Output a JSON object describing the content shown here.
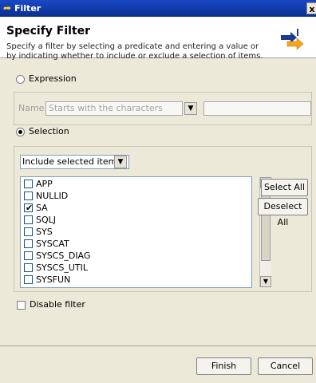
{
  "window": {
    "title": "Filter",
    "close_glyph": "x"
  },
  "banner": {
    "title": "Specify Filter",
    "description": "Specify a filter by selecting a predicate and entering a value or by indicating whether to include or exclude a selection of items.",
    "icon": "filter-arrows-icon"
  },
  "expression": {
    "radio_label": "Expression",
    "selected": false,
    "name_label": "Name:",
    "predicate_value": "Starts with the characters",
    "value_text": ""
  },
  "selection": {
    "radio_label": "Selection",
    "selected": true,
    "mode_value": "Include selected items",
    "items": [
      {
        "label": "APP",
        "checked": false
      },
      {
        "label": "NULLID",
        "checked": false
      },
      {
        "label": "SA",
        "checked": true
      },
      {
        "label": "SQLJ",
        "checked": false
      },
      {
        "label": "SYS",
        "checked": false
      },
      {
        "label": "SYSCAT",
        "checked": false
      },
      {
        "label": "SYSCS_DIAG",
        "checked": false
      },
      {
        "label": "SYSCS_UTIL",
        "checked": false
      },
      {
        "label": "SYSFUN",
        "checked": false
      }
    ],
    "select_all_label": "Select All",
    "deselect_all_label": "Deselect All"
  },
  "disable_filter": {
    "label": "Disable filter",
    "checked": false
  },
  "footer": {
    "finish_label": "Finish",
    "cancel_label": "Cancel"
  },
  "colors": {
    "titlebar": "#0a2f8f",
    "dialog_bg": "#ece9d8"
  }
}
